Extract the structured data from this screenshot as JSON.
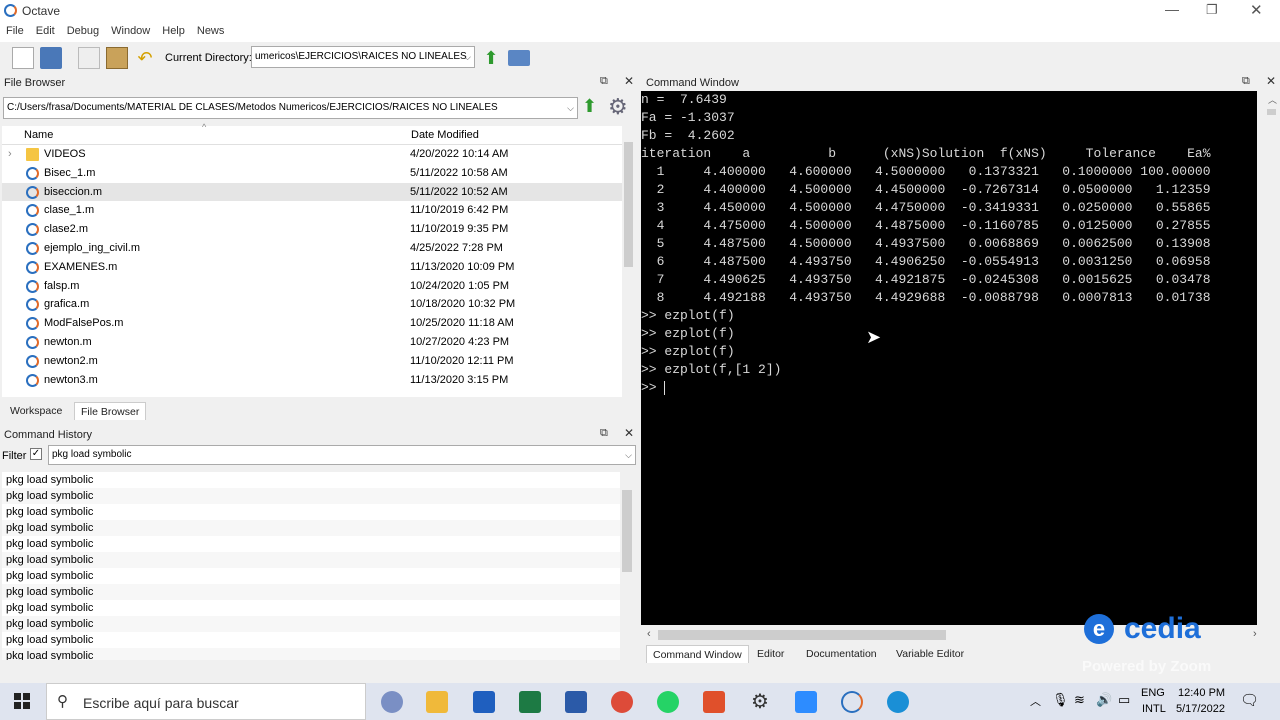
{
  "window": {
    "title": "Octave"
  },
  "menu": [
    "File",
    "Edit",
    "Debug",
    "Window",
    "Help",
    "News"
  ],
  "toolbar": {
    "current_dir_label": "Current Directory:",
    "current_dir_value": "umericos\\EJERCICIOS\\RAICES NO LINEALES"
  },
  "file_browser": {
    "title": "File Browser",
    "path": "C:/Users/frasa/Documents/MATERIAL DE CLASES/Metodos Numericos/EJERCICIOS/RAICES NO LINEALES",
    "col_name": "Name",
    "col_date": "Date Modified",
    "files": [
      {
        "name": "VIDEOS",
        "date": "4/20/2022 10:14 AM",
        "type": "folder"
      },
      {
        "name": "Bisec_1.m",
        "date": "5/11/2022 10:58 AM",
        "type": "m"
      },
      {
        "name": "biseccion.m",
        "date": "5/11/2022 10:52 AM",
        "type": "m"
      },
      {
        "name": "clase_1.m",
        "date": "11/10/2019 6:42 PM",
        "type": "m"
      },
      {
        "name": "clase2.m",
        "date": "11/10/2019 9:35 PM",
        "type": "m"
      },
      {
        "name": "ejemplo_ing_civil.m",
        "date": "4/25/2022 7:28 PM",
        "type": "m"
      },
      {
        "name": "EXAMENES.m",
        "date": "11/13/2020 10:09 PM",
        "type": "m"
      },
      {
        "name": "falsp.m",
        "date": "10/24/2020 1:05 PM",
        "type": "m"
      },
      {
        "name": "grafica.m",
        "date": "10/18/2020 10:32 PM",
        "type": "m"
      },
      {
        "name": "ModFalsePos.m",
        "date": "10/25/2020 11:18 AM",
        "type": "m"
      },
      {
        "name": "newton.m",
        "date": "10/27/2020 4:23 PM",
        "type": "m"
      },
      {
        "name": "newton2.m",
        "date": "11/10/2020 12:11 PM",
        "type": "m"
      },
      {
        "name": "newton3.m",
        "date": "11/13/2020 3:15 PM",
        "type": "m"
      }
    ],
    "tab_workspace": "Workspace",
    "tab_filebrowser": "File Browser"
  },
  "history": {
    "title": "Command History",
    "filter_label": "Filter",
    "filter_value": "pkg load symbolic",
    "entries": [
      "pkg load symbolic",
      "pkg load symbolic",
      "pkg load symbolic",
      "pkg load symbolic",
      "pkg load symbolic",
      "pkg load symbolic",
      "pkg load symbolic",
      "pkg load symbolic",
      "pkg load symbolic",
      "pkg load symbolic",
      "pkg load symbolic",
      "pkg load symbolic"
    ]
  },
  "command_window": {
    "title": "Command Window",
    "lines": [
      "n =  7.6439",
      "Fa = -1.3037",
      "Fb =  4.2602",
      "iteration    a          b      (xNS)Solution  f(xNS)     Tolerance    Ea%",
      "  1     4.400000   4.600000   4.5000000   0.1373321   0.1000000 100.00000",
      "  2     4.400000   4.500000   4.4500000  -0.7267314   0.0500000   1.12359",
      "  3     4.450000   4.500000   4.4750000  -0.3419331   0.0250000   0.55865",
      "  4     4.475000   4.500000   4.4875000  -0.1160785   0.0125000   0.27855",
      "  5     4.487500   4.500000   4.4937500   0.0068869   0.0062500   0.13908",
      "  6     4.487500   4.493750   4.4906250  -0.0554913   0.0031250   0.06958",
      "  7     4.490625   4.493750   4.4921875  -0.0245308   0.0015625   0.03478",
      "  8     4.492188   4.493750   4.4929688  -0.0088798   0.0007813   0.01738",
      ">> ezplot(f)",
      ">> ezplot(f)",
      ">> ezplot(f)",
      ">> ezplot(f,[1 2])",
      ">> "
    ],
    "tabs": [
      "Command Window",
      "Editor",
      "Documentation",
      "Variable Editor"
    ]
  },
  "watermark": {
    "brand": "cedia",
    "powered": "Powered by Zoom"
  },
  "taskbar": {
    "search_placeholder": "Escribe aquí para buscar",
    "lang1": "ENG",
    "lang2": "INTL",
    "time": "12:40 PM",
    "date": "5/17/2022"
  },
  "colors": {
    "accent": "#0078d7",
    "console_bg": "#000000",
    "console_fg": "#d8d8d8"
  }
}
